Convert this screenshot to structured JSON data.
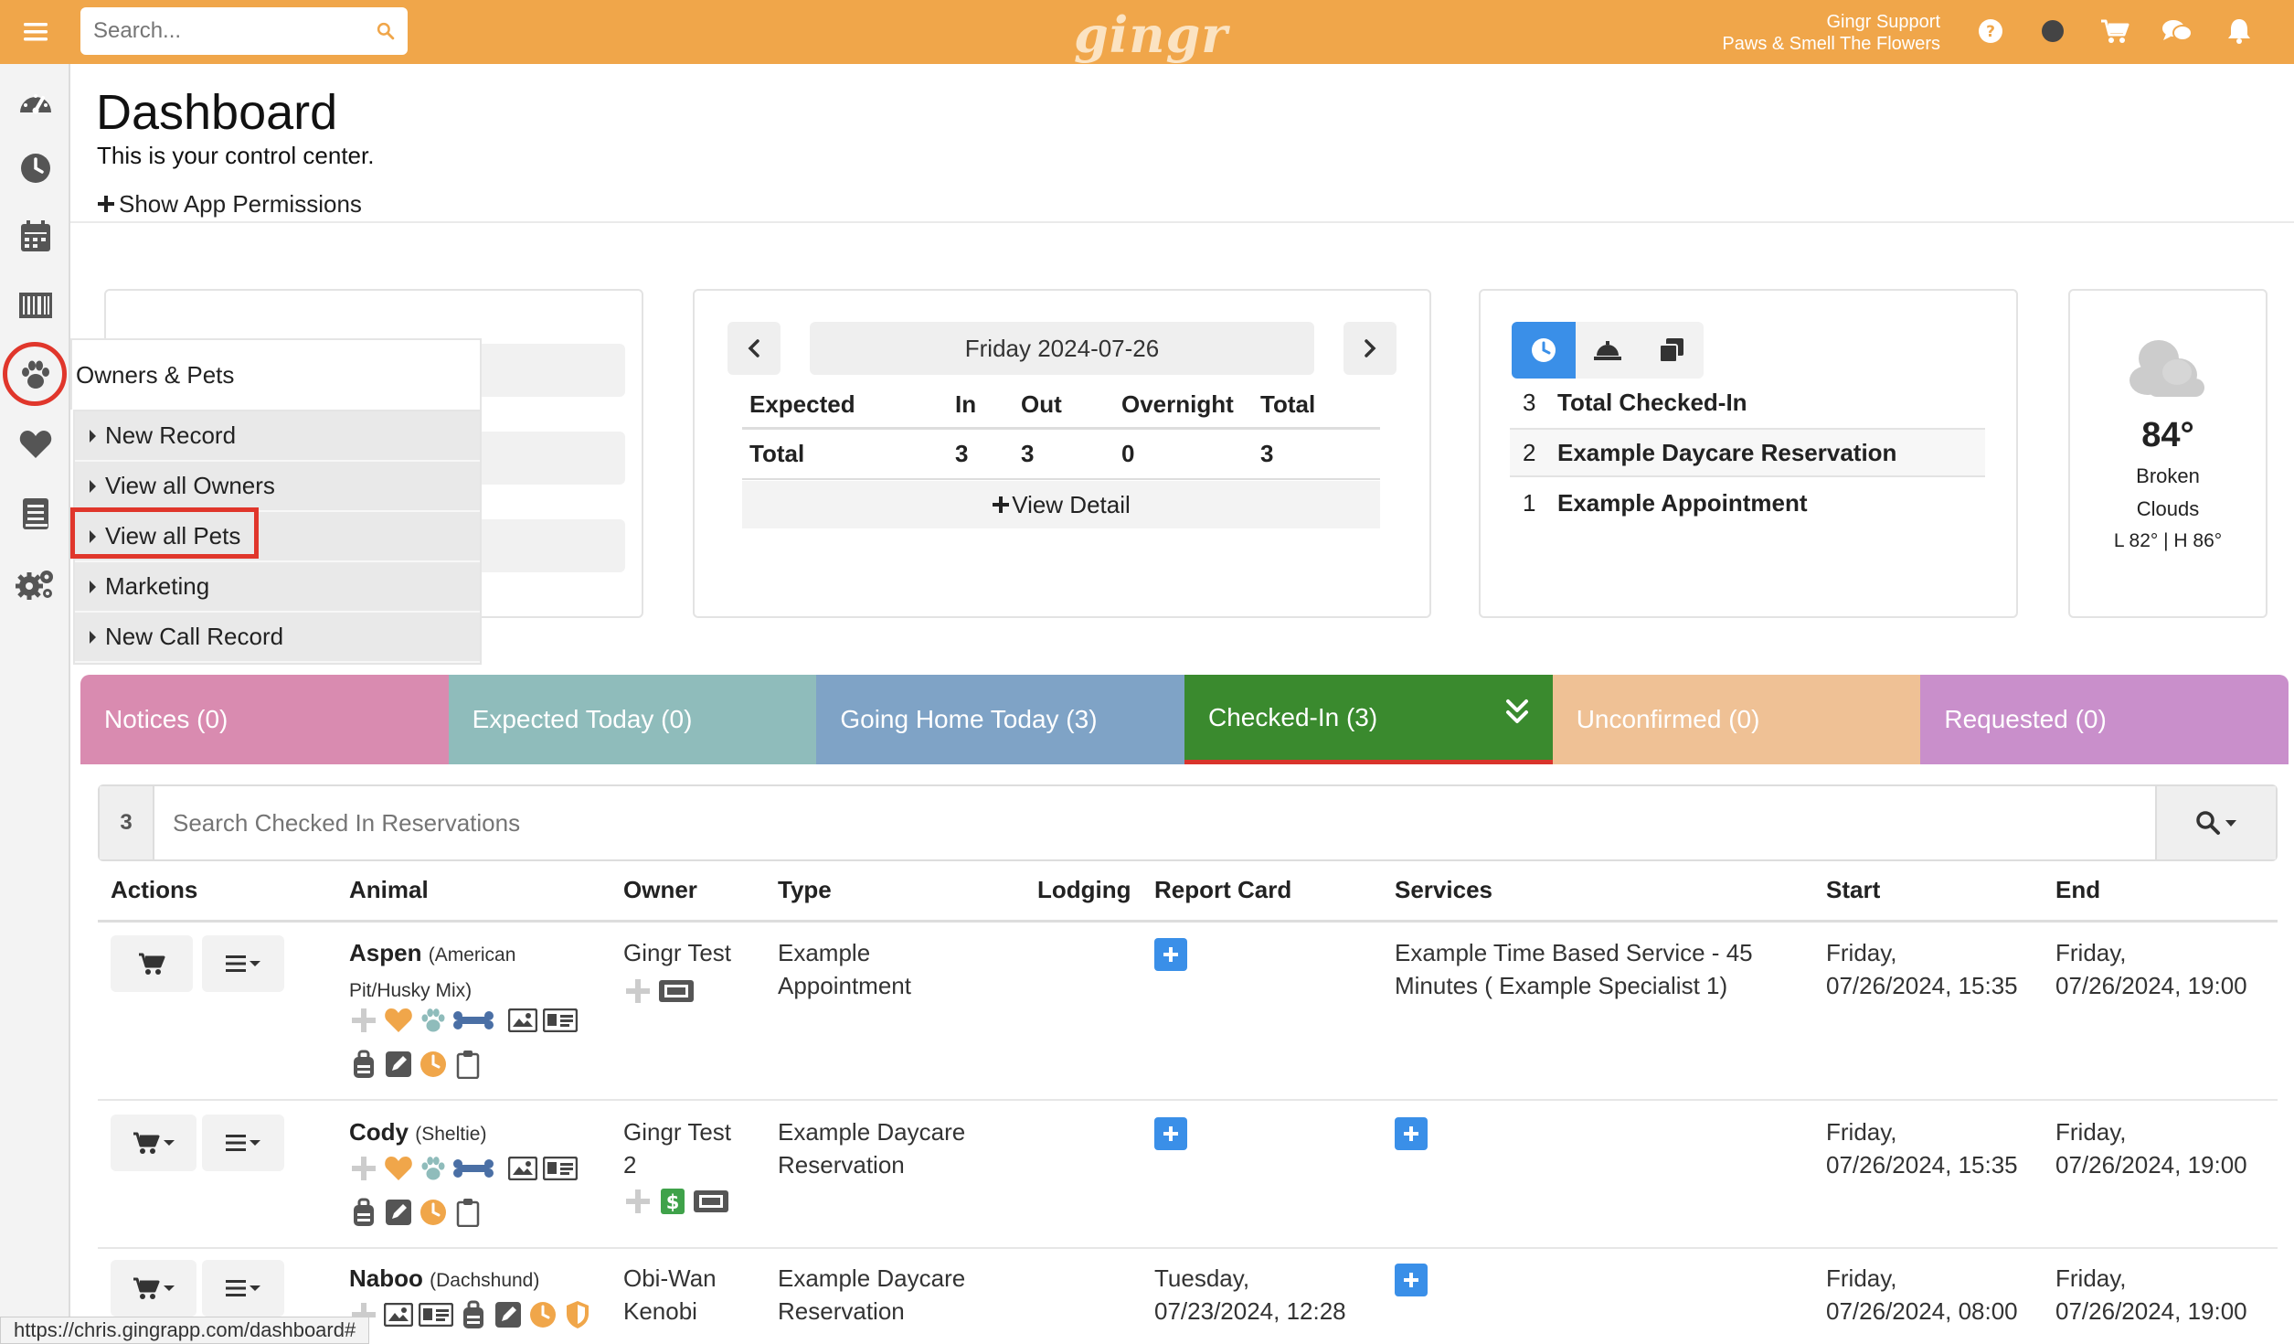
{
  "topbar": {
    "search_placeholder": "Search...",
    "logo": "gingr",
    "account_name": "Gingr Support",
    "account_location": "Paws & Smell The Flowers",
    "icons": [
      "help-icon",
      "status-dot-icon",
      "cart-icon",
      "chat-icon",
      "bell-icon"
    ]
  },
  "sidebar": {
    "icons": [
      "dashboard-gauge-icon",
      "clock-icon",
      "calendar-icon",
      "barcode-icon",
      "paw-icon",
      "heart-icon",
      "book-icon",
      "settings-gears-icon"
    ]
  },
  "header": {
    "title": "Dashboard",
    "subtitle": "This is your control center.",
    "permissions_link": "Show App Permissions"
  },
  "flyout": {
    "title": "Owners & Pets",
    "items": [
      {
        "label": "New Record"
      },
      {
        "label": "View all Owners"
      },
      {
        "label": "View all Pets"
      },
      {
        "label": "Marketing"
      },
      {
        "label": "New Call Record"
      }
    ]
  },
  "expected_card": {
    "date": "Friday 2024-07-26",
    "columns": [
      "Expected",
      "In",
      "Out",
      "Overnight",
      "Total"
    ],
    "row": {
      "label": "Total",
      "in": "3",
      "out": "3",
      "overnight": "0",
      "total": "3"
    },
    "view_detail": "View Detail"
  },
  "checkin_card": {
    "rows": [
      {
        "count": "3",
        "label": "Total Checked-In"
      },
      {
        "count": "2",
        "label": "Example Daycare Reservation"
      },
      {
        "count": "1",
        "label": "Example Appointment"
      }
    ]
  },
  "weather": {
    "temp": "84°",
    "line1": "Broken",
    "line2": "Clouds",
    "range": "L 82° | H 86°"
  },
  "tabs": [
    {
      "label": "Notices (0)",
      "color": "#d98bb0"
    },
    {
      "label": "Expected Today (0)",
      "color": "#8fbcbb"
    },
    {
      "label": "Going Home Today (3)",
      "color": "#7fa3c6"
    },
    {
      "label": "Checked-In (3)",
      "color": "#3a8a2e"
    },
    {
      "label": "Unconfirmed (0)",
      "color": "#efc195"
    },
    {
      "label": "Requested (0)",
      "color": "#c98fcb"
    }
  ],
  "filter": {
    "count": "3",
    "placeholder": "Search Checked In Reservations"
  },
  "table": {
    "columns": [
      "Actions",
      "Animal",
      "Owner",
      "Type",
      "Lodging",
      "Report Card",
      "Services",
      "Start",
      "End"
    ],
    "rows": [
      {
        "name": "Aspen",
        "breed_l1": "(American",
        "breed_l2": "Pit/Husky Mix)",
        "owner_l1": "Gingr Test",
        "owner_l2": "",
        "type_l1": "Example",
        "type_l2": "Appointment",
        "report_card_l1": "",
        "report_card_l2": "",
        "services_l1": "Example Time Based Service - 45",
        "services_l2": "Minutes ( Example Specialist 1)",
        "start_l1": "Friday,",
        "start_l2": "07/26/2024, 15:35",
        "end_l1": "Friday,",
        "end_l2": "07/26/2024, 19:00"
      },
      {
        "name": "Cody",
        "breed_l1": "(Sheltie)",
        "breed_l2": "",
        "owner_l1": "Gingr Test",
        "owner_l2": "2",
        "type_l1": "Example Daycare",
        "type_l2": "Reservation",
        "report_card_l1": "",
        "report_card_l2": "",
        "services_l1": "",
        "services_l2": "",
        "start_l1": "Friday,",
        "start_l2": "07/26/2024, 15:35",
        "end_l1": "Friday,",
        "end_l2": "07/26/2024, 19:00"
      },
      {
        "name": "Naboo",
        "breed_l1": "(Dachshund)",
        "breed_l2": "",
        "owner_l1": "Obi-Wan",
        "owner_l2": "Kenobi",
        "type_l1": "Example Daycare",
        "type_l2": "Reservation",
        "report_card_l1": "Tuesday,",
        "report_card_l2": "07/23/2024, 12:28",
        "services_l1": "",
        "services_l2": "",
        "start_l1": "Friday,",
        "start_l2": "07/26/2024, 08:00",
        "end_l1": "Friday,",
        "end_l2": "07/26/2024, 19:00"
      }
    ]
  },
  "status_bar": {
    "url": "https://chris.gingrapp.com/dashboard#"
  }
}
